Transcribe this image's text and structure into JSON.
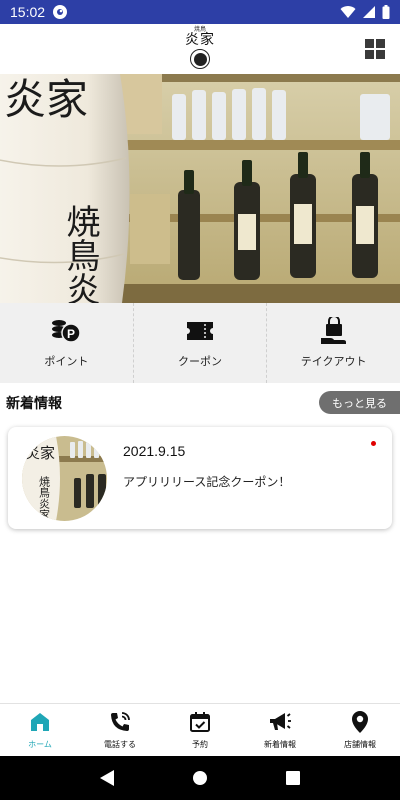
{
  "status_bar": {
    "time": "15:02"
  },
  "header": {
    "logo_small_text": "焼鳥",
    "logo_title": "炎家",
    "menu_icon": "grid-menu-icon"
  },
  "hero": {
    "lantern_text": "焼鳥炎家",
    "lantern_top_text": "炎家"
  },
  "quick_menu": [
    {
      "label": "ポイント",
      "icon": "points-coins-icon"
    },
    {
      "label": "クーポン",
      "icon": "coupon-ticket-icon"
    },
    {
      "label": "テイクアウト",
      "icon": "takeout-bag-icon"
    }
  ],
  "news": {
    "title": "新着情報",
    "more_label": "もっと見る",
    "items": [
      {
        "date": "2021.9.15",
        "text": "アプリリリース記念クーポン！",
        "unread": true
      }
    ]
  },
  "bottom_nav": {
    "accent_color": "#1fa6b6",
    "items": [
      {
        "label": "ホーム",
        "icon": "home-icon",
        "active": true
      },
      {
        "label": "電話する",
        "icon": "phone-icon",
        "active": false
      },
      {
        "label": "予約",
        "icon": "calendar-check-icon",
        "active": false
      },
      {
        "label": "新着情報",
        "icon": "megaphone-icon",
        "active": false
      },
      {
        "label": "店舗情報",
        "icon": "map-pin-icon",
        "active": false
      }
    ]
  },
  "colors": {
    "status_bar": "#2d3fa6",
    "unread_dot": "#e00000",
    "more_button": "#6f6f6f"
  }
}
